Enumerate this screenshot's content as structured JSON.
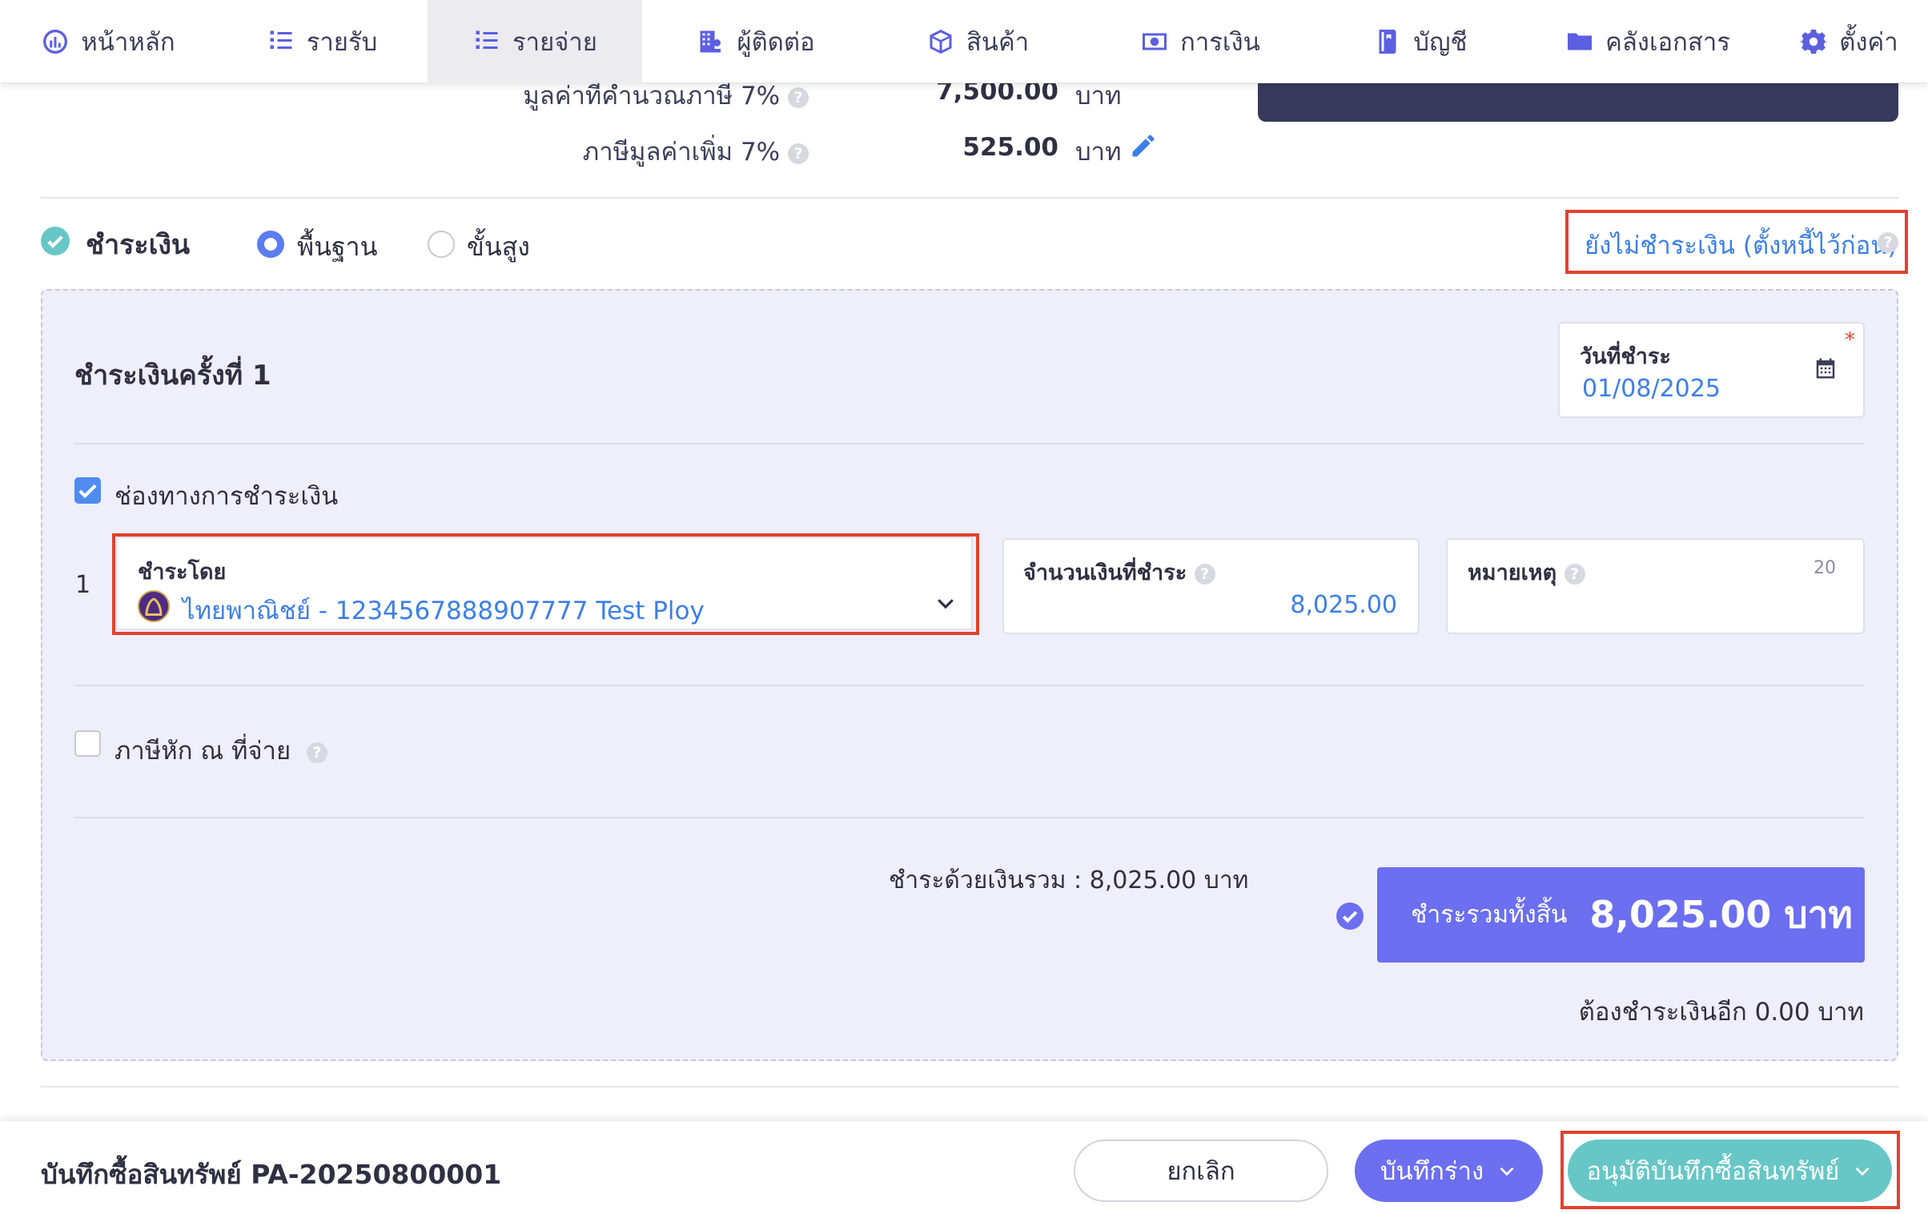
{
  "nav": {
    "items": [
      {
        "label": "หน้าหลัก",
        "icon": "dashboard-icon"
      },
      {
        "label": "รายรับ",
        "icon": "income-list-icon"
      },
      {
        "label": "รายจ่าย",
        "icon": "expense-list-icon",
        "active": true
      },
      {
        "label": "ผู้ติดต่อ",
        "icon": "contacts-icon"
      },
      {
        "label": "สินค้า",
        "icon": "product-box-icon"
      },
      {
        "label": "การเงิน",
        "icon": "money-icon"
      },
      {
        "label": "บัญชี",
        "icon": "ledger-icon"
      },
      {
        "label": "คลังเอกสาร",
        "icon": "folder-icon"
      },
      {
        "label": "ตั้งค่า",
        "icon": "gear-icon"
      }
    ]
  },
  "summary": {
    "vat_base_label": "มูลค่าที่คำนวณภาษี 7%",
    "vat_base_value": "7,500.00",
    "vat_label": "ภาษีมูลค่าเพิ่ม 7%",
    "vat_value": "525.00",
    "unit": "บาท"
  },
  "payment": {
    "title": "ชำระเงิน",
    "mode_basic": "พื้นฐาน",
    "mode_advanced": "ขั้นสูง",
    "defer_link": "ยังไม่ชำระเงิน (ตั้งหนี้ไว้ก่อน)",
    "installment_title": "ชำระเงินครั้งที่ 1",
    "date_label": "วันที่ชำระ",
    "date_value": "01/08/2025",
    "channel_label": "ช่องทางการชำระเงิน",
    "row_number": "1",
    "pay_by_label": "ชำระโดย",
    "pay_by_value": "ไทยพาณิชย์ - 1234567888907777 Test Ploy",
    "amount_label": "จำนวนเงินที่ชำระ",
    "amount_value": "8,025.00",
    "note_label": "หมายเหตุ",
    "note_counter": "20",
    "wht_label": "ภาษีหัก ณ ที่จ่าย",
    "paid_total_text": "ชำระด้วยเงินรวม :  8,025.00 บาท",
    "grand_total_label": "ชำระรวมทั้งสิ้น",
    "grand_total_value": "8,025.00 บาท",
    "remaining_text": "ต้องชำระเงินอีก 0.00 บาท"
  },
  "footer": {
    "doc_title": "บันทึกซื้อสินทรัพย์ PA-20250800001",
    "cancel_label": "ยกเลิก",
    "draft_label": "บันทึกร่าง",
    "approve_label": "อนุมัติบันทึกซื้อสินทรัพย์"
  },
  "colors": {
    "accent": "#6b6ff0",
    "link": "#3d7fe6",
    "teal": "#67c7c6",
    "highlight": "#e2412e"
  }
}
